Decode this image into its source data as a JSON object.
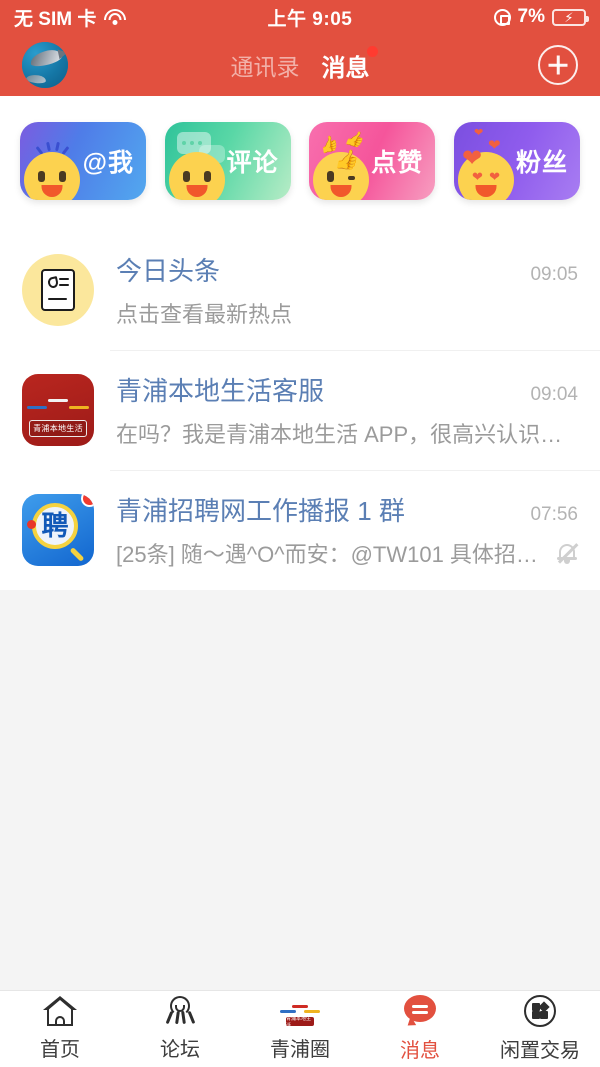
{
  "status_bar": {
    "carrier": "无 SIM 卡",
    "wifi_icon": "wifi-icon",
    "time": "上午 9:05",
    "rotation_lock_icon": "rotation-lock-icon",
    "battery_percent": "7%",
    "battery_icon": "battery-charging-icon"
  },
  "nav_bar": {
    "avatar": "user-avatar",
    "tabs": [
      {
        "label": "通讯录",
        "active": false,
        "badge": false
      },
      {
        "label": "消息",
        "active": true,
        "badge": true
      }
    ],
    "add_button": "add-button",
    "background_color": "#e2503f"
  },
  "quick_cards": [
    {
      "label": "@我",
      "icon": "mention-face-icon",
      "color": "#4f7ce8"
    },
    {
      "label": "评论",
      "icon": "comment-face-icon",
      "color": "#59d7a6"
    },
    {
      "label": "点赞",
      "icon": "like-face-icon",
      "color": "#f5559b"
    },
    {
      "label": "粉丝",
      "icon": "fans-face-icon",
      "color": "#8f5ced"
    }
  ],
  "messages": [
    {
      "icon": "toutiao-news-icon",
      "title": "今日头条",
      "preview": "点击查看最新热点",
      "time": "09:05",
      "unread": false,
      "muted": false
    },
    {
      "icon": "qingpu-life-service-icon",
      "icon_label": "青浦本地生活",
      "title": "青浦本地生活客服",
      "preview": "在吗？我是青浦本地生活 APP，很高兴认识…",
      "time": "09:04",
      "unread": false,
      "muted": false
    },
    {
      "icon": "job-recruit-group-icon",
      "icon_text": "聘",
      "title": "青浦招聘网工作播报 1 群",
      "preview": "[25条] 随～遇^O^而安：@TW101 具体招哪…",
      "time": "07:56",
      "unread": true,
      "muted": true,
      "mute_icon": "bell-muted-icon"
    }
  ],
  "tab_bar": {
    "items": [
      {
        "label": "首页",
        "icon": "home-icon",
        "active": false
      },
      {
        "label": "论坛",
        "icon": "forum-icon",
        "active": false
      },
      {
        "label": "青浦圈",
        "icon": "qingpu-circle-icon",
        "icon_label": "青浦本地生活",
        "active": false
      },
      {
        "label": "消息",
        "icon": "message-bubble-icon",
        "active": true
      },
      {
        "label": "闲置交易",
        "icon": "marketplace-grid-icon",
        "active": false
      }
    ],
    "active_color": "#e2503f"
  }
}
